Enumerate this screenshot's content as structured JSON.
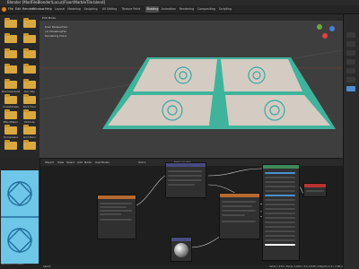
{
  "window": {
    "title": "Blender [ModFileBlender\\Locus\\Floor\\MarbleTile.blend]"
  },
  "menu": [
    "File",
    "Edit",
    "Render",
    "Window",
    "Help"
  ],
  "workspace_tabs": [
    "Layout",
    "Modeling",
    "Sculpting",
    "UV Editing",
    "Texture Paint",
    "Shading",
    "Animation",
    "Rendering",
    "Compositing",
    "Scripting"
  ],
  "active_tab": "Shading",
  "file_browser": {
    "items": [
      "",
      "",
      "",
      "",
      "",
      "",
      "",
      "",
      "Dev Download",
      "Dev Ray",
      "CrossStripes",
      "Dark Floor",
      "BlendPaper",
      "Dirtmap",
      "Dinnerware",
      "Grid Deco",
      "",
      ""
    ]
  },
  "viewport": {
    "mode": "Edit Mode",
    "overlay_lines": [
      "User Perspective",
      "(1) ModelingTile",
      "Rendering Done"
    ]
  },
  "node_editor": {
    "header": [
      "Object",
      "View",
      "Select",
      "Add",
      "Node",
      "Use Nodes",
      "Slot 1",
      "Material.001"
    ],
    "nodes": [
      {
        "name": "Image Texture"
      },
      {
        "name": "Mapping"
      },
      {
        "name": "Image Texture"
      },
      {
        "name": "Principled BSDF"
      },
      {
        "name": "Material Output"
      },
      {
        "name": "Sphere Preview"
      }
    ]
  },
  "image_editor": {
    "label": "MarbleCorner512"
  },
  "status": {
    "left": "Select",
    "right": "Verts 1,234 | Faces 1,024 | Tris 2,048 | Objects 1/1 | 2.90.1"
  },
  "colors": {
    "accent": "#4b8fd1",
    "folder": "#d9a83f",
    "tile_edge": "#3fb39c"
  }
}
